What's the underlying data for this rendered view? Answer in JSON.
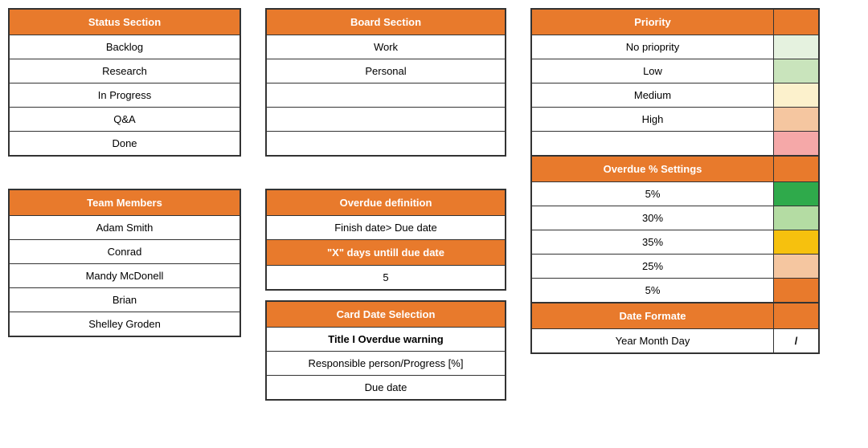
{
  "status": {
    "header": "Status Section",
    "items": [
      "Backlog",
      "Research",
      "In Progress",
      "Q&A",
      "Done"
    ]
  },
  "team": {
    "header": "Team Members",
    "items": [
      "Adam Smith",
      "Conrad",
      "Mandy McDonell",
      "Brian",
      "Shelley Groden"
    ]
  },
  "board": {
    "header": "Board Section",
    "items": [
      "Work",
      "Personal",
      "",
      "",
      ""
    ]
  },
  "overdue_def": {
    "header": "Overdue definition",
    "value": "Finish date> Due date",
    "sub_header": "\"X\" days untill due date",
    "sub_value": "5"
  },
  "card_date": {
    "header": "Card Date Selection",
    "items": [
      {
        "text": "Title I Overdue warning",
        "bold": true
      },
      {
        "text": "Responsible person/Progress [%]",
        "bold": false
      },
      {
        "text": "Due date",
        "bold": false
      }
    ]
  },
  "priority": {
    "header": "Priority",
    "rows": [
      {
        "label": "No prioprity",
        "swatch": "sw-noprio"
      },
      {
        "label": "Low",
        "swatch": "sw-low"
      },
      {
        "label": "Medium",
        "swatch": "sw-med"
      },
      {
        "label": "High",
        "swatch": "sw-high"
      },
      {
        "label": "",
        "swatch": "sw-crit"
      }
    ]
  },
  "overdue_settings": {
    "header": "Overdue % Settings",
    "rows": [
      {
        "label": "5%",
        "swatch": "sw-ov1"
      },
      {
        "label": "30%",
        "swatch": "sw-ov2"
      },
      {
        "label": "35%",
        "swatch": "sw-ov3"
      },
      {
        "label": "25%",
        "swatch": "sw-ov4"
      },
      {
        "label": "5%",
        "swatch": "sw-ov5"
      }
    ]
  },
  "date_format": {
    "header": "Date Formate",
    "label": "Year Month Day",
    "separator": "/"
  }
}
